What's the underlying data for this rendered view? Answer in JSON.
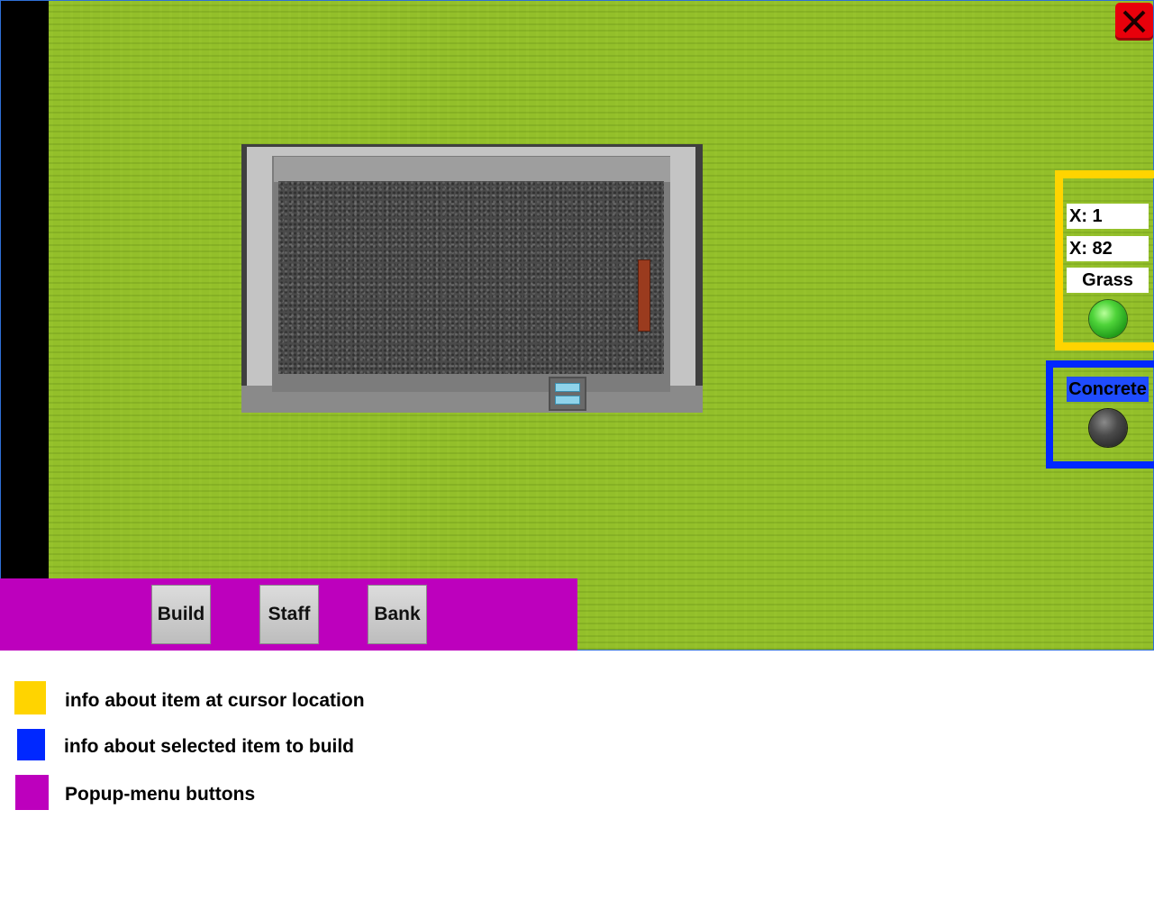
{
  "game": {
    "close_label": "X"
  },
  "cursor_info": {
    "x_label": "X: 1",
    "y_label": "X: 82",
    "tile_name": "Grass",
    "tile_indicator_color": "#3fc534"
  },
  "build_info": {
    "selected_item": "Concrete",
    "item_indicator_color": "#3b3b3b"
  },
  "menu": {
    "buttons": [
      "Build",
      "Staff",
      "Bank"
    ]
  },
  "legend": [
    {
      "color": "#ffd400",
      "text": "info about item at cursor location"
    },
    {
      "color": "#0028ff",
      "text": "info about selected item to build"
    },
    {
      "color": "#bd00bd",
      "text": "Popup-menu buttons"
    }
  ]
}
